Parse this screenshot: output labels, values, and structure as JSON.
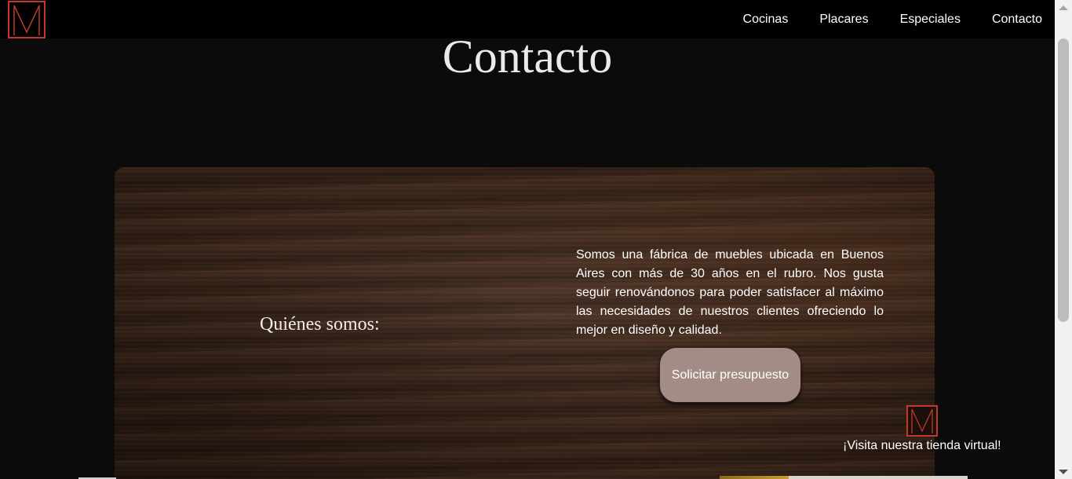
{
  "brand": {
    "logo_icon": "m-monogram-logo-icon",
    "accent_color": "#c0392b"
  },
  "nav": {
    "items": [
      {
        "label": "Cocinas"
      },
      {
        "label": "Placares"
      },
      {
        "label": "Especiales"
      },
      {
        "label": "Contacto"
      }
    ]
  },
  "main": {
    "title": "Contacto",
    "about_heading": "Quiénes somos:",
    "about_text": "Somos una fábrica de muebles ubicada en Buenos Aires con más de 30 años en el rubro. Nos gusta seguir renovándonos para poder satisfacer al máximo las necesidades de nuestros clientes ofreciendo lo mejor en diseño y calidad.",
    "quote_button": "Solicitar presupuesto"
  },
  "store": {
    "link_text": "¡Visita nuestra tienda virtual!",
    "icon": "m-monogram-logo-icon"
  },
  "colors": {
    "background": "#0b0b0b",
    "navbar": "#000000",
    "button": "#a48c86",
    "wood": "#382519"
  }
}
